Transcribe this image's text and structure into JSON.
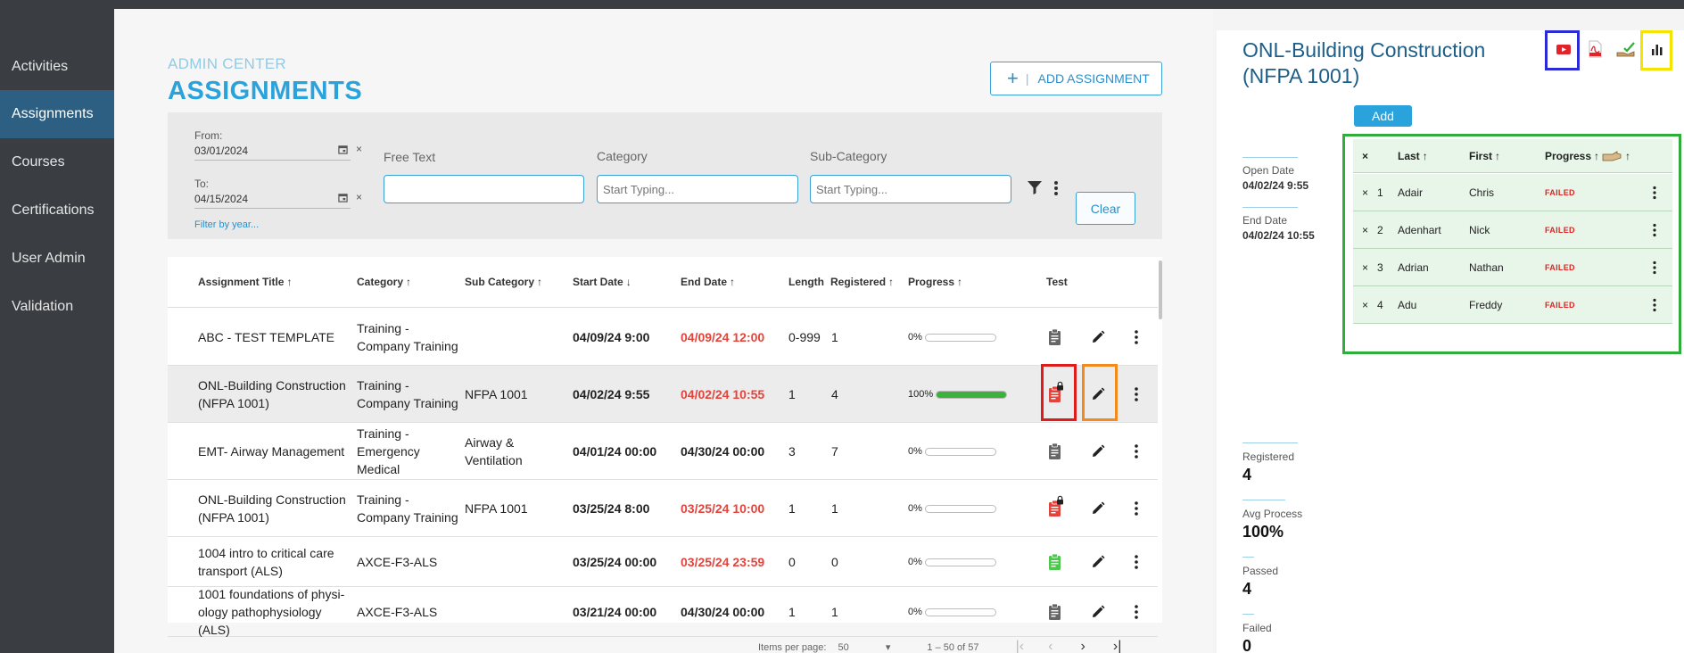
{
  "sidebar": {
    "items": [
      {
        "label": "Activities"
      },
      {
        "label": "Assignments"
      },
      {
        "label": "Courses"
      },
      {
        "label": "Certifications"
      },
      {
        "label": "User Admin"
      },
      {
        "label": "Validation"
      }
    ],
    "active_index": 1
  },
  "header": {
    "pre_title": "ADMIN CENTER",
    "title": "ASSIGNMENTS",
    "add_button": "ADD ASSIGNMENT",
    "add_separator": "|"
  },
  "filters": {
    "from_label": "From:",
    "from_value": "03/01/2024",
    "to_label": "To:",
    "to_value": "04/15/2024",
    "filter_by_year": "Filter by year...",
    "free_text_label": "Free Text",
    "free_text_value": "",
    "category_label": "Category",
    "category_placeholder": "Start Typing...",
    "subcategory_label": "Sub-Category",
    "subcategory_placeholder": "Start Typing...",
    "clear_label": "Clear",
    "date_clear_glyph": "×"
  },
  "table": {
    "columns": {
      "title": "Assignment Title",
      "category": "Category",
      "sub_category": "Sub Category",
      "start_date": "Start Date",
      "end_date": "End Date",
      "length": "Length",
      "registered": "Registered",
      "progress": "Progress",
      "test": "Test"
    },
    "rows": [
      {
        "title": "ABC - TEST TEMPLATE",
        "category": "Training - Company Training",
        "sub_category": "",
        "start": "04/09/24 9:00",
        "end": "04/09/24 12:00",
        "end_overdue": true,
        "length": "0-999",
        "registered": "1",
        "progress_text": "0%",
        "progress": 0,
        "test_icon": "clipboard-icon",
        "test_color": "#666666",
        "locked": false
      },
      {
        "title": "ONL-Building Construction (NFPA 1001)",
        "category": "Training - Company Training",
        "sub_category": "NFPA 1001",
        "start": "04/02/24 9:55",
        "end": "04/02/24 10:55",
        "end_overdue": true,
        "length": "1",
        "registered": "4",
        "progress_text": "100%",
        "progress": 100,
        "test_icon": "clipboard-lock-icon",
        "test_color": "#e2443c",
        "locked": true
      },
      {
        "title": "EMT- Airway Management",
        "category": "Training - Emergency Medical",
        "sub_category": "Airway & Ventilation",
        "start": "04/01/24 00:00",
        "end": "04/30/24 00:00",
        "end_overdue": false,
        "length": "3",
        "registered": "7",
        "progress_text": "0%",
        "progress": 0,
        "test_icon": "clipboard-icon",
        "test_color": "#666666",
        "locked": false
      },
      {
        "title": "ONL-Building Construction (NFPA 1001)",
        "category": "Training - Company Training",
        "sub_category": "NFPA 1001",
        "start": "03/25/24 8:00",
        "end": "03/25/24 10:00",
        "end_overdue": true,
        "length": "1",
        "registered": "1",
        "progress_text": "0%",
        "progress": 0,
        "test_icon": "clipboard-lock-icon",
        "test_color": "#e2443c",
        "locked": true
      },
      {
        "title": "1004 intro to critical care transport (ALS)",
        "category": "AXCE-F3-ALS",
        "sub_category": "",
        "start": "03/25/24 00:00",
        "end": "03/25/24 23:59",
        "end_overdue": true,
        "length": "0",
        "registered": "0",
        "progress_text": "0%",
        "progress": 0,
        "test_icon": "clipboard-icon",
        "test_color": "#4cc94c",
        "locked": false
      },
      {
        "title": "1001 foundations of physi- ology pathophysiology (ALS)",
        "category": "AXCE-F3-ALS",
        "sub_category": "",
        "start": "03/21/24 00:00",
        "end": "04/30/24 00:00",
        "end_overdue": false,
        "length": "1",
        "registered": "1",
        "progress_text": "0%",
        "progress": 0,
        "test_icon": "clipboard-icon",
        "test_color": "#666666",
        "locked": false
      }
    ]
  },
  "pager": {
    "items_per_page_label": "Items per page:",
    "items_per_page": "50",
    "range": "1 – 50 of 57"
  },
  "panel": {
    "title": "ONL-Building Construction (NFPA 1001)",
    "add_label": "Add",
    "open_date_label": "Open Date",
    "open_date": "04/02/24 9:55",
    "end_date_label": "End Date",
    "end_date": "04/02/24 10:55",
    "icons": [
      "video-icon",
      "pdf-icon",
      "hand-check-icon",
      "bar-chart-icon"
    ],
    "registrants_columns": {
      "remove": "×",
      "last": "Last",
      "first": "First",
      "progress": "Progress"
    },
    "registrants": [
      {
        "num": "1",
        "last": "Adair",
        "first": "Chris",
        "status": "FAILED"
      },
      {
        "num": "2",
        "last": "Adenhart",
        "first": "Nick",
        "status": "FAILED"
      },
      {
        "num": "3",
        "last": "Adrian",
        "first": "Nathan",
        "status": "FAILED"
      },
      {
        "num": "4",
        "last": "Adu",
        "first": "Freddy",
        "status": "FAILED"
      }
    ],
    "stats": [
      {
        "label": "Registered",
        "value": "4"
      },
      {
        "label": "Avg Process",
        "value": "100%"
      },
      {
        "label": "Passed",
        "value": "4"
      },
      {
        "label": "Failed",
        "value": "0"
      }
    ]
  },
  "colors": {
    "accent": "#2aa3dc",
    "sidebar_bg": "#3a3d42",
    "sidebar_active": "#2c5f82",
    "overdue_red": "#e2443c",
    "progress_green": "#3cb23c",
    "highlight_red": "#e01b1b",
    "highlight_orange": "#f28a1c",
    "highlight_blue": "#2b2bd6",
    "highlight_yellow": "#f5e400",
    "highlight_green": "#2fae3a"
  }
}
